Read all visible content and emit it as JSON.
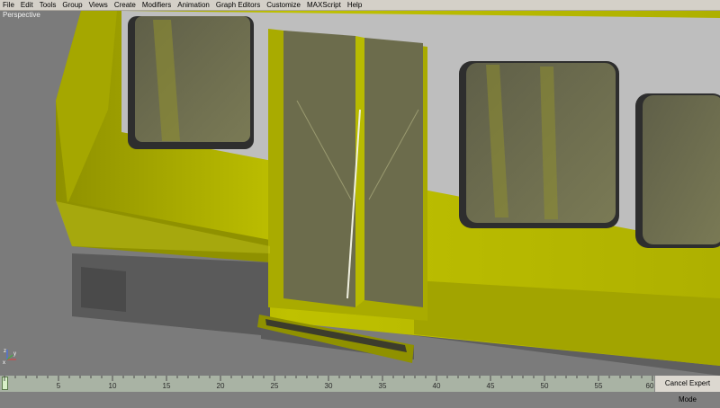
{
  "menu": {
    "items": [
      "File",
      "Edit",
      "Tools",
      "Group",
      "Views",
      "Create",
      "Modifiers",
      "Animation",
      "Graph Editors",
      "Customize",
      "MAXScript",
      "Help"
    ]
  },
  "viewport": {
    "label": "Perspective",
    "axis_labels": {
      "x": "x",
      "y": "y",
      "z": "z"
    },
    "colors": {
      "body": "#b5b700",
      "window_frame": "#bebebe",
      "glass": "#6e6e50",
      "background": "#7b7b7b"
    }
  },
  "timeline": {
    "tick_labels": [
      "5",
      "10",
      "15",
      "20",
      "25",
      "30",
      "35",
      "40",
      "45",
      "50",
      "55",
      "60"
    ],
    "expert_mode_label": "Cancel Expert Mode",
    "current_frame": 0
  }
}
